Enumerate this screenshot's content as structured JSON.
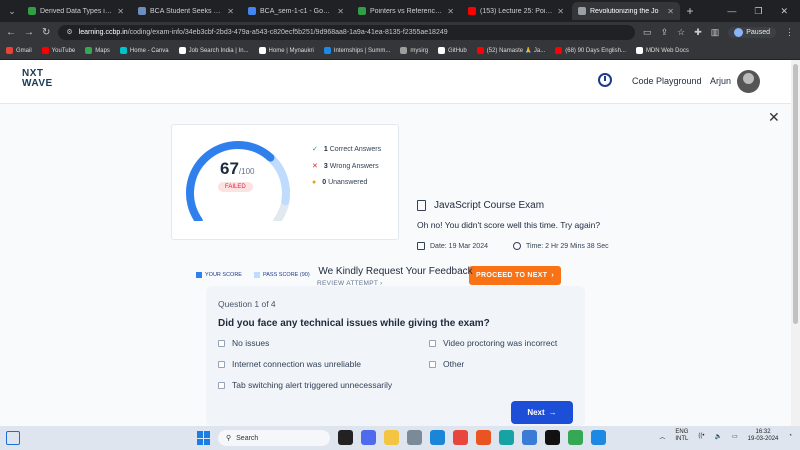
{
  "browser": {
    "tabs": [
      {
        "title": "Derived Data Types in C++",
        "color": "#2f9e44",
        "active": false
      },
      {
        "title": "BCA Student Seeks Help",
        "color": "#6c8ebf",
        "active": false
      },
      {
        "title": "BCA_sem-1-c1 - Google D",
        "color": "#4285f4",
        "active": false
      },
      {
        "title": "Pointers vs References in C",
        "color": "#2f9e44",
        "active": false
      },
      {
        "title": "(153) Lecture 25: Pointers i",
        "color": "#ff0000",
        "active": false
      },
      {
        "title": "Revolutionizing the Jo",
        "color": "#9aa0a6",
        "active": true
      }
    ],
    "url_domain": "learning.ccbp.in",
    "url_path": "/coding/exam-info/34eb3cbf-2bd3-479a-a543-c820ecf5b251/9d968aa8-1a9a-41ea-8135-f2355ae18249",
    "profile_status": "Paused",
    "bookmarks": [
      {
        "label": "Gmail",
        "color": "#ea4335"
      },
      {
        "label": "YouTube",
        "color": "#ff0000"
      },
      {
        "label": "Maps",
        "color": "#34a853"
      },
      {
        "label": "Home - Canva",
        "color": "#00c4cc"
      },
      {
        "label": "Job Search India | In...",
        "color": "#ffffff"
      },
      {
        "label": "Home | Mynaukri",
        "color": "#ffffff"
      },
      {
        "label": "Internships | Summ...",
        "color": "#1e88e5"
      },
      {
        "label": "mysirg",
        "color": "#9e9e9e"
      },
      {
        "label": "GitHub",
        "color": "#ffffff"
      },
      {
        "label": "(52) Namaste 🙏 Ja...",
        "color": "#ff0000"
      },
      {
        "label": "(68) 90 Days English...",
        "color": "#ff0000"
      },
      {
        "label": "MDN Web Docs",
        "color": "#ffffff"
      }
    ]
  },
  "header": {
    "logo_line1": "NXT",
    "logo_line2": "WAVE",
    "code_playground": "Code Playground",
    "user_name": "Arjun"
  },
  "score": {
    "value": "67",
    "max": "/100",
    "score_fraction": 0.67,
    "pass_fraction": 0.9,
    "status": "FAILED",
    "correct_count": "1",
    "correct_label": "Correct Answers",
    "wrong_count": "3",
    "wrong_label": "Wrong Answers",
    "unanswered_count": "0",
    "unanswered_label": "Unanswered",
    "legend_your": "YOUR SCORE",
    "legend_pass": "PASS SCORE (90)",
    "review_label": "REVIEW ATTEMPT",
    "colors": {
      "your": "#2f80ed",
      "pass": "#bfdbfe",
      "track": "#e2e8f0"
    }
  },
  "exam": {
    "title": "JavaScript Course Exam",
    "message": "Oh no! You didn't score well this time. Try again?",
    "date": "Date: 19 Mar 2024",
    "time": "Time: 2 Hr 29 Mins 38 Sec",
    "proceed_label": "PROCEED TO NEXT"
  },
  "feedback": {
    "title": "We Kindly Request Your Feedback",
    "question_number": "Question 1 of 4",
    "question": "Did you face any technical issues while giving the exam?",
    "options": [
      "No issues",
      "Video proctoring was incorrect",
      "Internet connection was unreliable",
      "Other",
      "Tab switching alert triggered unnecessarily"
    ],
    "next_label": "Next"
  },
  "taskbar": {
    "search_placeholder": "Search",
    "lang_line1": "ENG",
    "lang_line2": "INTL",
    "time": "16:32",
    "date": "19-03-2024"
  }
}
